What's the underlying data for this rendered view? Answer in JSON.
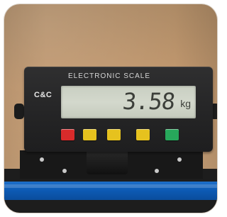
{
  "indicator": {
    "brand": "C&C",
    "title": "ELECTRONIC   SCALE",
    "display": {
      "tag": "",
      "reading": "3.58",
      "unit": "kg"
    },
    "buttons": [
      {
        "id": "btn-1",
        "label": "",
        "color": "#d92b2b"
      },
      {
        "id": "btn-2",
        "label": "",
        "color": "#e6c21e"
      },
      {
        "id": "btn-3",
        "label": "",
        "color": "#e6c21e"
      },
      {
        "id": "btn-4",
        "label": "",
        "color": "#e6c21e"
      },
      {
        "id": "btn-5",
        "label": "",
        "color": "#27a85b"
      }
    ]
  },
  "colors": {
    "wall": "#c49a70",
    "housing": "#242425",
    "lcd": "#d3d8cc",
    "rail": "#0d5bb5"
  }
}
